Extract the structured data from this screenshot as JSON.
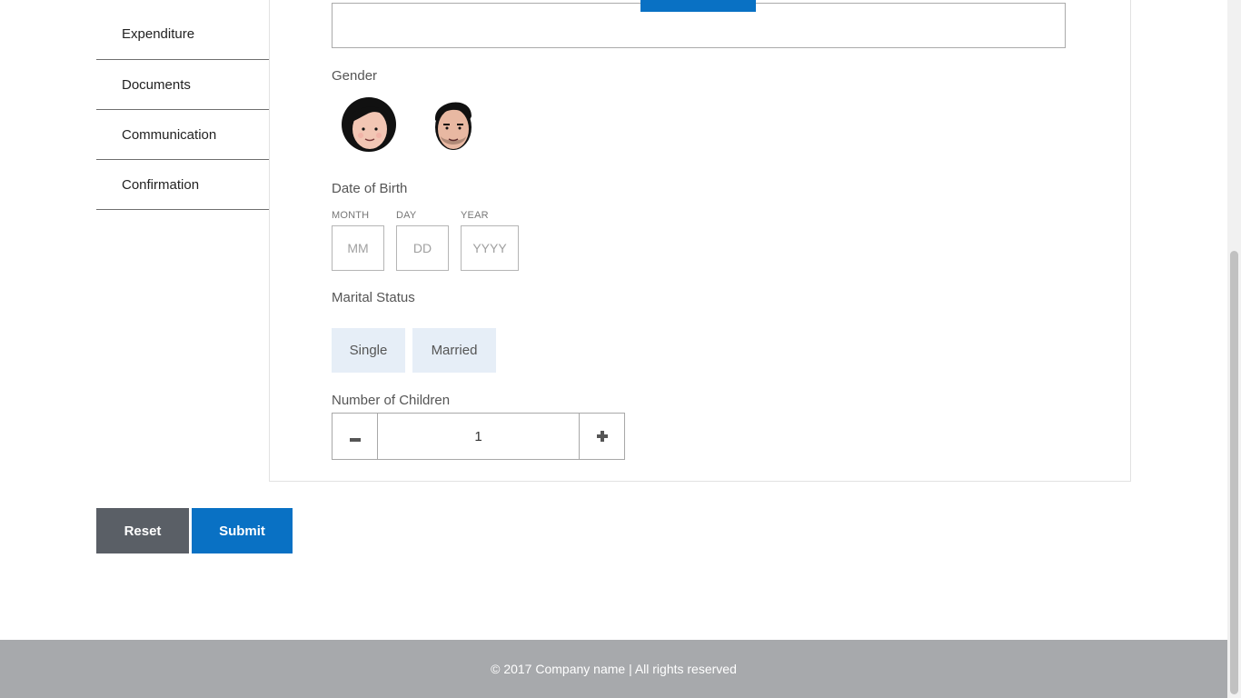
{
  "sidebar": {
    "items": [
      {
        "label": "Expenditure"
      },
      {
        "label": "Documents"
      },
      {
        "label": "Communication"
      },
      {
        "label": "Confirmation"
      }
    ]
  },
  "form": {
    "gender": {
      "label": "Gender",
      "options": [
        {
          "icon": "female-avatar-icon"
        },
        {
          "icon": "male-avatar-icon"
        }
      ]
    },
    "dob": {
      "label": "Date of Birth",
      "month": {
        "label": "MONTH",
        "placeholder": "MM"
      },
      "day": {
        "label": "DAY",
        "placeholder": "DD"
      },
      "year": {
        "label": "YEAR",
        "placeholder": "YYYY"
      }
    },
    "marital_status": {
      "label": "Marital Status",
      "options": [
        "Single",
        "Married"
      ]
    },
    "children": {
      "label": "Number of Children",
      "value": "1",
      "minus_icon": "minus-icon",
      "plus_icon": "plus-icon"
    }
  },
  "actions": {
    "reset_label": "Reset",
    "submit_label": "Submit"
  },
  "footer": {
    "text": "© 2017 Company name | All rights reserved"
  },
  "colors": {
    "primary": "#0971c4",
    "reset": "#5a5f66",
    "option_bg": "#e6eef7",
    "footer_bg": "#a7a9ac"
  }
}
